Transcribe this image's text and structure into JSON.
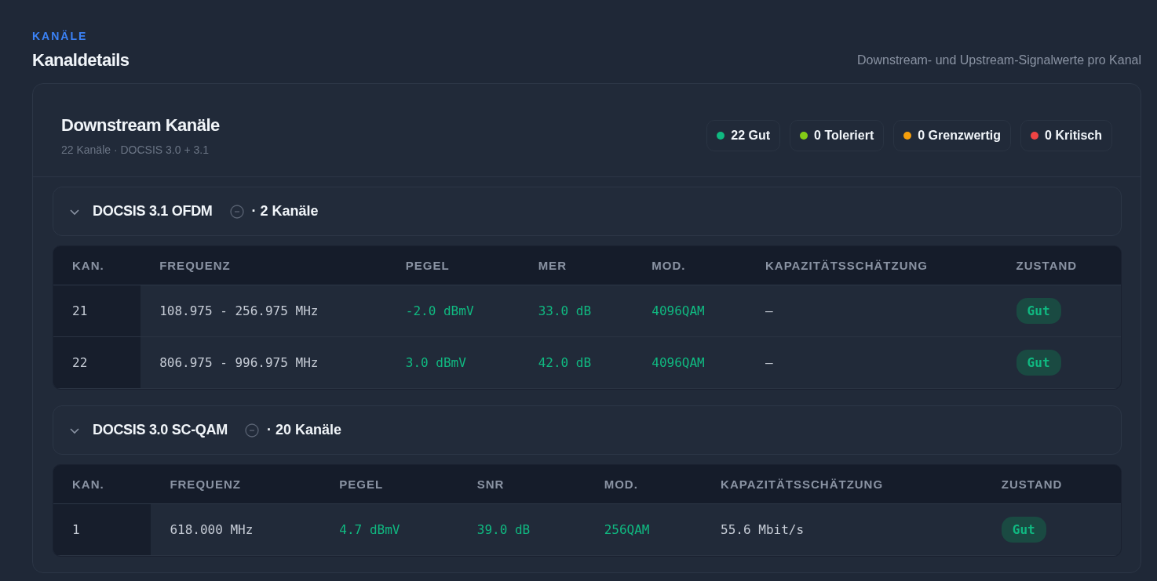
{
  "section": {
    "eyebrow": "KANÄLE",
    "title": "Kanaldetails",
    "description": "Downstream- und Upstream-Signalwerte pro Kanal"
  },
  "card": {
    "title": "Downstream Kanäle",
    "subtitle": "22 Kanäle · DOCSIS 3.0 + 3.1",
    "legend": [
      {
        "label": "22 Gut",
        "color": "#10b981"
      },
      {
        "label": "0 Toleriert",
        "color": "#84cc16"
      },
      {
        "label": "0 Grenzwertig",
        "color": "#f59e0b"
      },
      {
        "label": "0 Kritisch",
        "color": "#ef4444"
      }
    ],
    "groups": [
      {
        "title": "DOCSIS 3.1 OFDM",
        "count": "· 2 Kanäle",
        "expanded": true,
        "columns": [
          "KAN.",
          "FREQUENZ",
          "PEGEL",
          "MER",
          "MOD.",
          "KAPAZITÄTSSCHÄTZUNG",
          "ZUSTAND"
        ],
        "rows": [
          {
            "cells": [
              {
                "text": "21",
                "kind": "id"
              },
              {
                "text": "108.975 - 256.975 MHz",
                "kind": "plain"
              },
              {
                "text": "-2.0 dBmV",
                "kind": "good"
              },
              {
                "text": "33.0 dB",
                "kind": "good"
              },
              {
                "text": "4096QAM",
                "kind": "good"
              },
              {
                "text": "—",
                "kind": "plain"
              },
              {
                "text": "Gut",
                "kind": "badge"
              }
            ]
          },
          {
            "cells": [
              {
                "text": "22",
                "kind": "id"
              },
              {
                "text": "806.975 - 996.975 MHz",
                "kind": "plain"
              },
              {
                "text": "3.0 dBmV",
                "kind": "good"
              },
              {
                "text": "42.0 dB",
                "kind": "good"
              },
              {
                "text": "4096QAM",
                "kind": "good"
              },
              {
                "text": "—",
                "kind": "plain"
              },
              {
                "text": "Gut",
                "kind": "badge"
              }
            ]
          }
        ]
      },
      {
        "title": "DOCSIS 3.0 SC-QAM",
        "count": "· 20 Kanäle",
        "expanded": true,
        "columns": [
          "KAN.",
          "FREQUENZ",
          "PEGEL",
          "SNR",
          "MOD.",
          "KAPAZITÄTSSCHÄTZUNG",
          "ZUSTAND"
        ],
        "rows": [
          {
            "cells": [
              {
                "text": "1",
                "kind": "id"
              },
              {
                "text": "618.000 MHz",
                "kind": "plain"
              },
              {
                "text": "4.7 dBmV",
                "kind": "good"
              },
              {
                "text": "39.0 dB",
                "kind": "good"
              },
              {
                "text": "256QAM",
                "kind": "good"
              },
              {
                "text": "55.6 Mbit/s",
                "kind": "plain"
              },
              {
                "text": "Gut",
                "kind": "badge"
              }
            ]
          }
        ]
      }
    ]
  }
}
